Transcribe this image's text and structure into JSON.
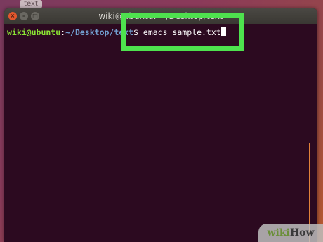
{
  "desktop": {
    "icon_label": "text"
  },
  "window": {
    "title": "wiki@ubuntu: ~/Desktop/text",
    "buttons": {
      "close": "×",
      "minimize": "–",
      "maximize": "□"
    }
  },
  "terminal": {
    "prompt_user": "wiki@ubuntu",
    "prompt_separator": ":",
    "prompt_path": "~/Desktop/text",
    "prompt_symbol": "$ ",
    "command": "emacs sample.txt"
  },
  "watermark": {
    "brand_part1": "wiki",
    "brand_part2": "How"
  },
  "colors": {
    "terminal_bg": "#2c0a20",
    "user_green": "#8ae234",
    "path_blue": "#729fcf",
    "highlight_green": "#4ee24e"
  }
}
